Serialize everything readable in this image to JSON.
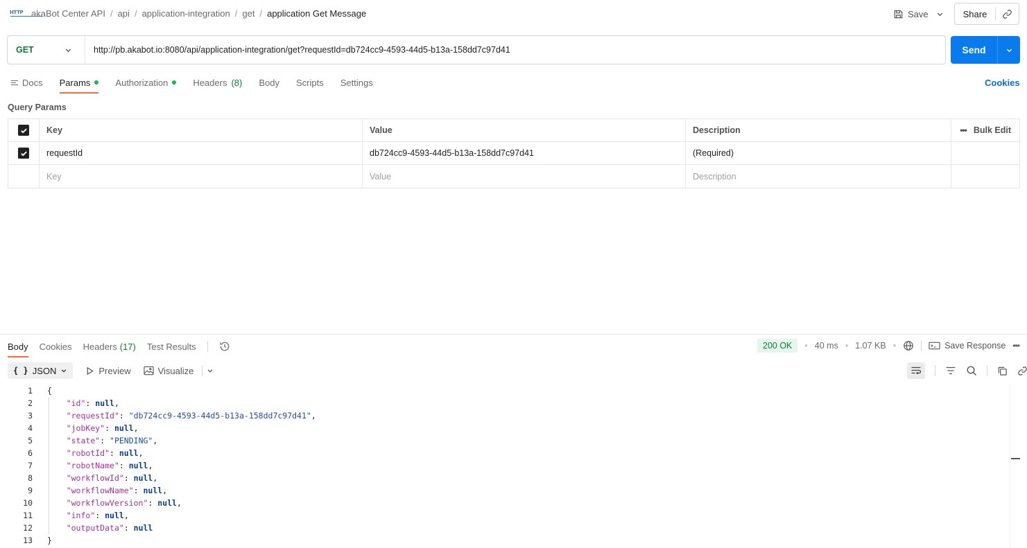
{
  "breadcrumb": {
    "icon": "http-request-icon",
    "icon_label": "HTTP",
    "items": [
      "akaBot Center API",
      "api",
      "application-integration",
      "get"
    ],
    "current": "application Get Message"
  },
  "header_actions": {
    "save_label": "Save",
    "share_label": "Share"
  },
  "request": {
    "method": "GET",
    "url": "http://pb.akabot.io:8080/api/application-integration/get?requestId=db724cc9-4593-44d5-b13a-158dd7c97d41",
    "send_label": "Send"
  },
  "request_tabs": {
    "docs": "Docs",
    "params": "Params",
    "authorization": "Authorization",
    "headers": "Headers",
    "headers_count": "(8)",
    "body": "Body",
    "scripts": "Scripts",
    "settings": "Settings",
    "active": "Params",
    "cookies_link": "Cookies"
  },
  "query_params": {
    "title": "Query Params",
    "columns": {
      "key": "Key",
      "value": "Value",
      "description": "Description",
      "bulk_edit": "Bulk Edit"
    },
    "rows": [
      {
        "checked": true,
        "key": "requestId",
        "value": "db724cc9-4593-44d5-b13a-158dd7c97d41",
        "description": "(Required)"
      }
    ],
    "placeholders": {
      "key": "Key",
      "value": "Value",
      "description": "Description"
    }
  },
  "response": {
    "tabs": {
      "body": "Body",
      "cookies": "Cookies",
      "headers": "Headers",
      "headers_count": "(17)",
      "test_results": "Test Results",
      "active": "Body"
    },
    "status": "200 OK",
    "time": "40 ms",
    "size": "1.07 KB",
    "save_response_label": "Save Response",
    "format": {
      "selected": "JSON",
      "preview": "Preview",
      "visualize": "Visualize"
    },
    "code_lines": [
      {
        "num": "1",
        "text": "{"
      },
      {
        "num": "2",
        "key": "\"id\"",
        "val": "null",
        "type": "null",
        "comma": ","
      },
      {
        "num": "3",
        "key": "\"requestId\"",
        "val": "\"db724cc9-4593-44d5-b13a-158dd7c97d41\"",
        "type": "string",
        "comma": ","
      },
      {
        "num": "4",
        "key": "\"jobKey\"",
        "val": "null",
        "type": "null",
        "comma": ","
      },
      {
        "num": "5",
        "key": "\"state\"",
        "val": "\"PENDING\"",
        "type": "string",
        "comma": ","
      },
      {
        "num": "6",
        "key": "\"robotId\"",
        "val": "null",
        "type": "null",
        "comma": ","
      },
      {
        "num": "7",
        "key": "\"robotName\"",
        "val": "null",
        "type": "null",
        "comma": ","
      },
      {
        "num": "8",
        "key": "\"workflowId\"",
        "val": "null",
        "type": "null",
        "comma": ","
      },
      {
        "num": "9",
        "key": "\"workflowName\"",
        "val": "null",
        "type": "null",
        "comma": ","
      },
      {
        "num": "10",
        "key": "\"workflowVersion\"",
        "val": "null",
        "type": "null",
        "comma": ","
      },
      {
        "num": "11",
        "key": "\"info\"",
        "val": "null",
        "type": "null",
        "comma": ","
      },
      {
        "num": "12",
        "key": "\"outputData\"",
        "val": "null",
        "type": "null",
        "comma": ""
      },
      {
        "num": "13",
        "text": "}"
      }
    ]
  },
  "colors": {
    "accent_tab": "#ff6c37",
    "send_button": "#097bed",
    "method_get": "#0e7a36",
    "status_ok": "#0e7a36",
    "link": "#0a6ad6"
  }
}
